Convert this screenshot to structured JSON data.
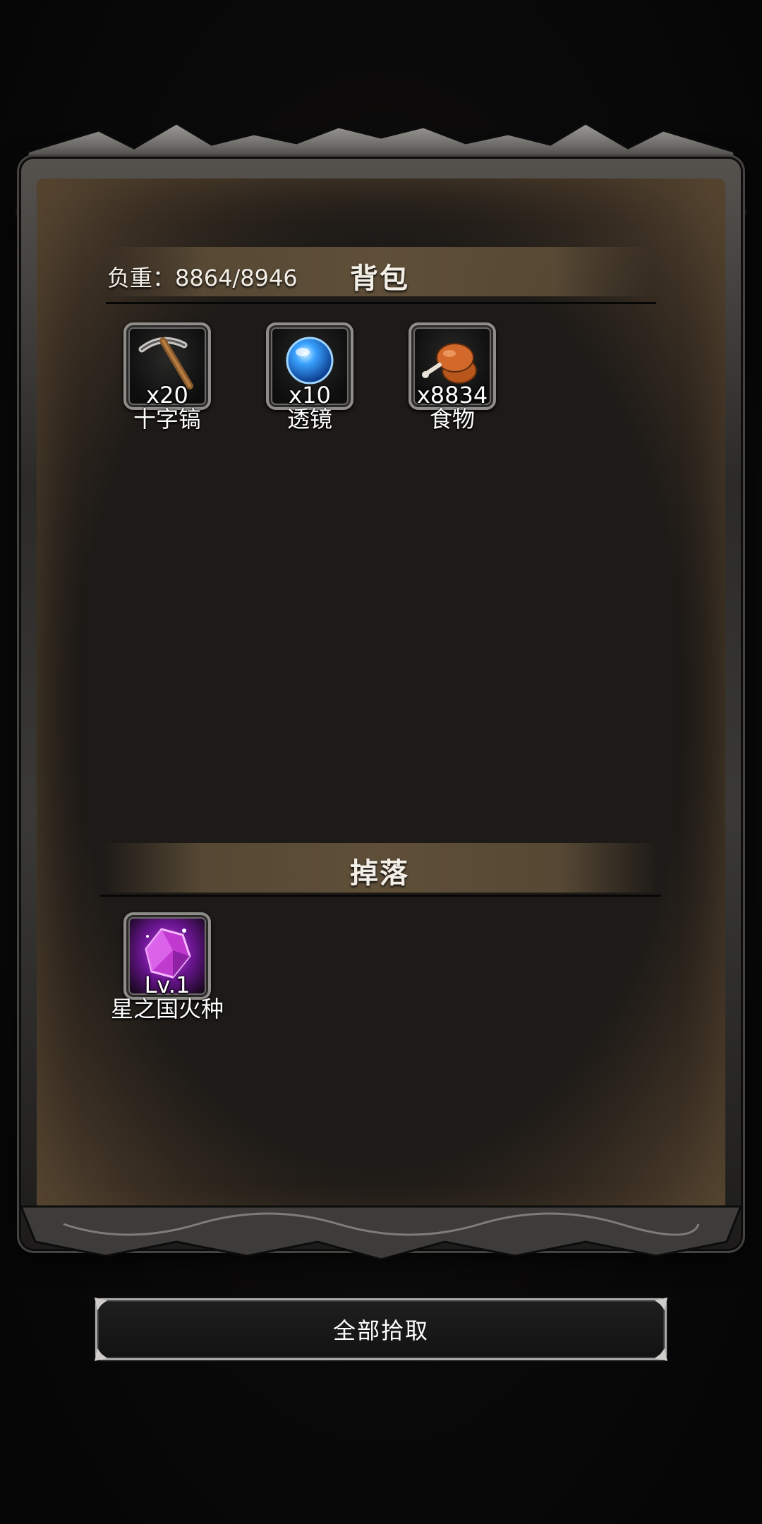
{
  "backpack": {
    "weight_label": "负重：8864/8946",
    "title": "背包",
    "items": [
      {
        "icon": "pickaxe-icon",
        "count": "x20",
        "name": "十字镐"
      },
      {
        "icon": "lens-icon",
        "count": "x10",
        "name": "透镜"
      },
      {
        "icon": "food-icon",
        "count": "x8834",
        "name": "食物"
      }
    ]
  },
  "drops": {
    "title": "掉落",
    "items": [
      {
        "icon": "crystal-icon",
        "count": "Lv.1",
        "name": "星之国火种"
      }
    ]
  },
  "actions": {
    "pickup_all_label": "全部拾取"
  },
  "colors": {
    "parchment": "#1d1a17",
    "header_band": "#5f4f39",
    "frame_metal": "#8f8d89"
  }
}
